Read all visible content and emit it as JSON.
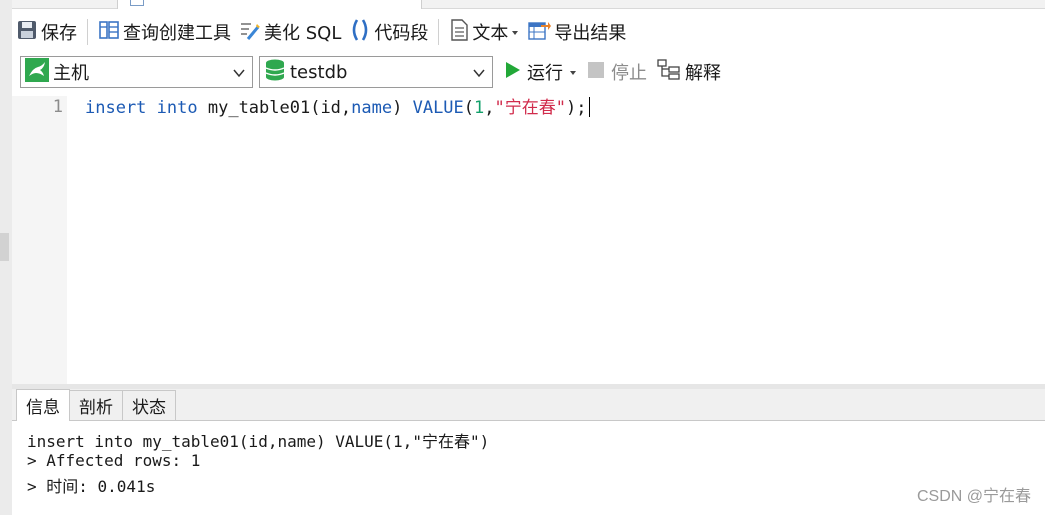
{
  "toolbar": {
    "save_label": "保存",
    "query_builder_label": "查询创建工具",
    "beautify_label": "美化 SQL",
    "snippet_label": "代码段",
    "text_label": "文本",
    "export_label": "导出结果"
  },
  "selectors": {
    "connection": "主机",
    "database": "testdb"
  },
  "actions": {
    "run_label": "运行",
    "stop_label": "停止",
    "explain_label": "解释"
  },
  "editor": {
    "line_number": "1",
    "tokens": {
      "t1": "insert",
      "t2": " ",
      "t3": "into",
      "t4": " my_table01(id,",
      "t5": "name",
      "t6": ") ",
      "t7": "VALUE",
      "t8": "(",
      "t9": "1",
      "t10": ",",
      "t11": "\"宁在春\"",
      "t12": ");"
    }
  },
  "result_tabs": [
    "信息",
    "剖析",
    "状态"
  ],
  "result": {
    "line1": "insert into my_table01(id,name) VALUE(1,\"宁在春\")",
    "line2": "> Affected rows: 1",
    "line3": "> 时间: 0.041s"
  },
  "watermark": "CSDN @宁在春",
  "colors": {
    "keyword": "#1c5ab4",
    "number": "#12a06a",
    "string": "#d12c4c",
    "run_green": "#22a838"
  },
  "icons": {
    "save": "save-icon",
    "query_builder": "query-builder-icon",
    "beautify": "beautify-sql-icon",
    "snippet": "code-snippet-icon",
    "text": "text-document-icon",
    "export": "export-results-icon",
    "connection": "mysql-connection-icon",
    "database": "database-icon",
    "run": "play-icon",
    "stop": "stop-icon",
    "explain": "explain-icon"
  }
}
